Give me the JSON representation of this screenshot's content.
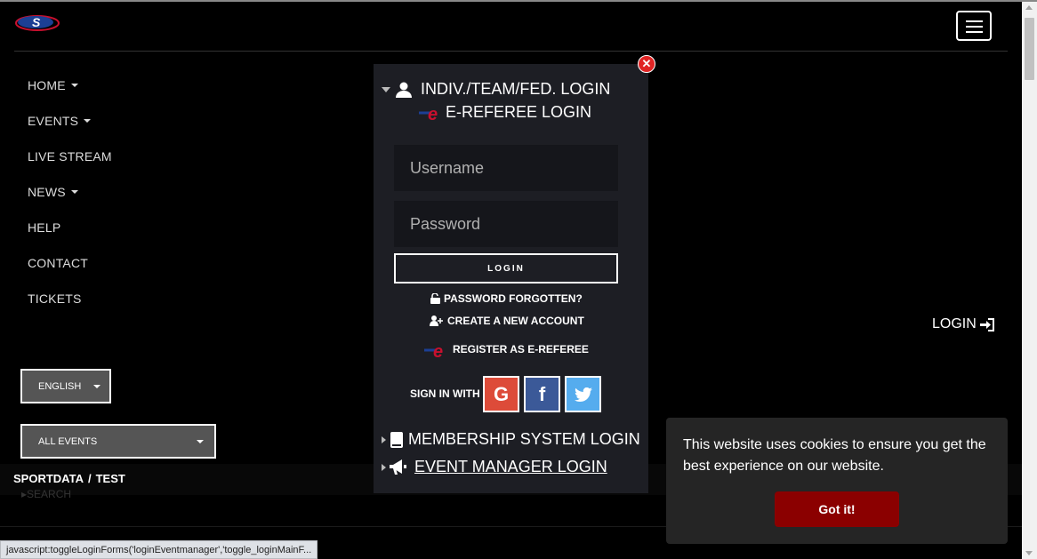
{
  "browser": {
    "status_url": "javascript:toggleLoginForms('loginEventmanager','toggle_loginMainF..."
  },
  "header": {
    "logo_icon": "sportdata-logo",
    "menu_icon": "hamburger-menu-icon"
  },
  "nav": {
    "items": [
      {
        "label": "HOME",
        "has_dropdown": true
      },
      {
        "label": "EVENTS",
        "has_dropdown": true
      },
      {
        "label": "LIVE STREAM",
        "has_dropdown": false
      },
      {
        "label": "NEWS",
        "has_dropdown": true
      },
      {
        "label": "HELP",
        "has_dropdown": false
      },
      {
        "label": "CONTACT",
        "has_dropdown": false
      },
      {
        "label": "TICKETS",
        "has_dropdown": false
      }
    ]
  },
  "language_select": {
    "value": "ENGLISH"
  },
  "events_select": {
    "value": "ALL EVENTS"
  },
  "breadcrumb": {
    "root": "SPORTDATA",
    "current": "TEST"
  },
  "search_link": "SEARCH",
  "login_link": {
    "label": "LOGIN",
    "icon": "sign-in-icon"
  },
  "login_modal": {
    "title": "INDIV./TEAM/FED. LOGIN",
    "subtitle": "E-REFEREE LOGIN",
    "username_placeholder": "Username",
    "password_placeholder": "Password",
    "login_button": "LOGIN",
    "password_forgotten": "PASSWORD FORGOTTEN?",
    "create_account": "CREATE A NEW ACCOUNT",
    "register_referee": "REGISTER AS E-REFEREE",
    "sign_in_with": "SIGN IN WITH",
    "social": [
      "google",
      "facebook",
      "twitter"
    ],
    "membership_login": "MEMBERSHIP SYSTEM LOGIN",
    "event_manager_login": "EVENT MANAGER LOGIN"
  },
  "cookie_banner": {
    "text": "This website uses cookies to ensure you get the best experience on our website.",
    "button": "Got it!",
    "button_color": "#8b0000"
  }
}
